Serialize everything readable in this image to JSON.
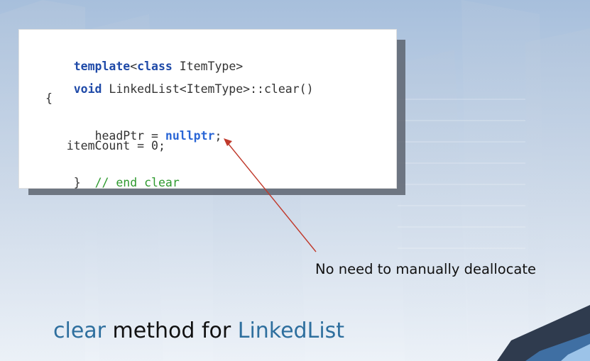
{
  "code": {
    "line1": {
      "keyword1": "template",
      "lt": "<",
      "keyword2": "class",
      "rest": " ItemType>"
    },
    "line2": {
      "keyword": "void",
      "rest": " LinkedList<ItemType>::clear()"
    },
    "line3": "{",
    "line4": {
      "indent": "   ",
      "pre": "headPtr = ",
      "keyword": "nullptr",
      "post": ";"
    },
    "line5": "   itemCount = 0;",
    "line6": {
      "brace": "}  ",
      "comment": "// end clear"
    }
  },
  "annotation": "No need to manually deallocate",
  "title": {
    "part1": "clear",
    "part2": " method for ",
    "part3": "LinkedList"
  },
  "colors": {
    "keyword": "#1f4aa8",
    "keyword_bright": "#2a66d6",
    "comment": "#2f9a2f",
    "accent": "#2e6f9e",
    "arrow": "#c0392b"
  }
}
